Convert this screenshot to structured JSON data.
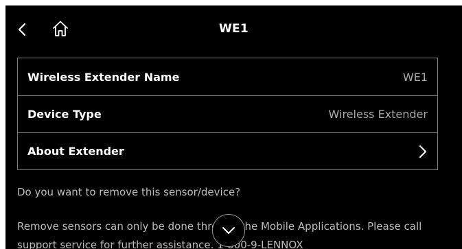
{
  "header": {
    "title": "WE1",
    "back_icon": "chevron-left-icon",
    "home_icon": "home-icon"
  },
  "details": [
    {
      "label": "Wireless Extender Name",
      "value": "WE1"
    },
    {
      "label": "Device Type",
      "value": "Wireless Extender"
    },
    {
      "label": "About Extender",
      "icon": "chevron-right-icon"
    }
  ],
  "remove_prompt": "Do you want to remove this sensor/device?",
  "remove_info": "Remove sensors can only be done through the Mobile Applications. Please call support service for further assistance. 1-800-9-LENNOX",
  "scroll_button_icon": "chevron-down-icon",
  "colors": {
    "background": "#000000",
    "text": "#ffffff",
    "muted_text": "#bdbdbd",
    "border": "#7a7a7a"
  }
}
